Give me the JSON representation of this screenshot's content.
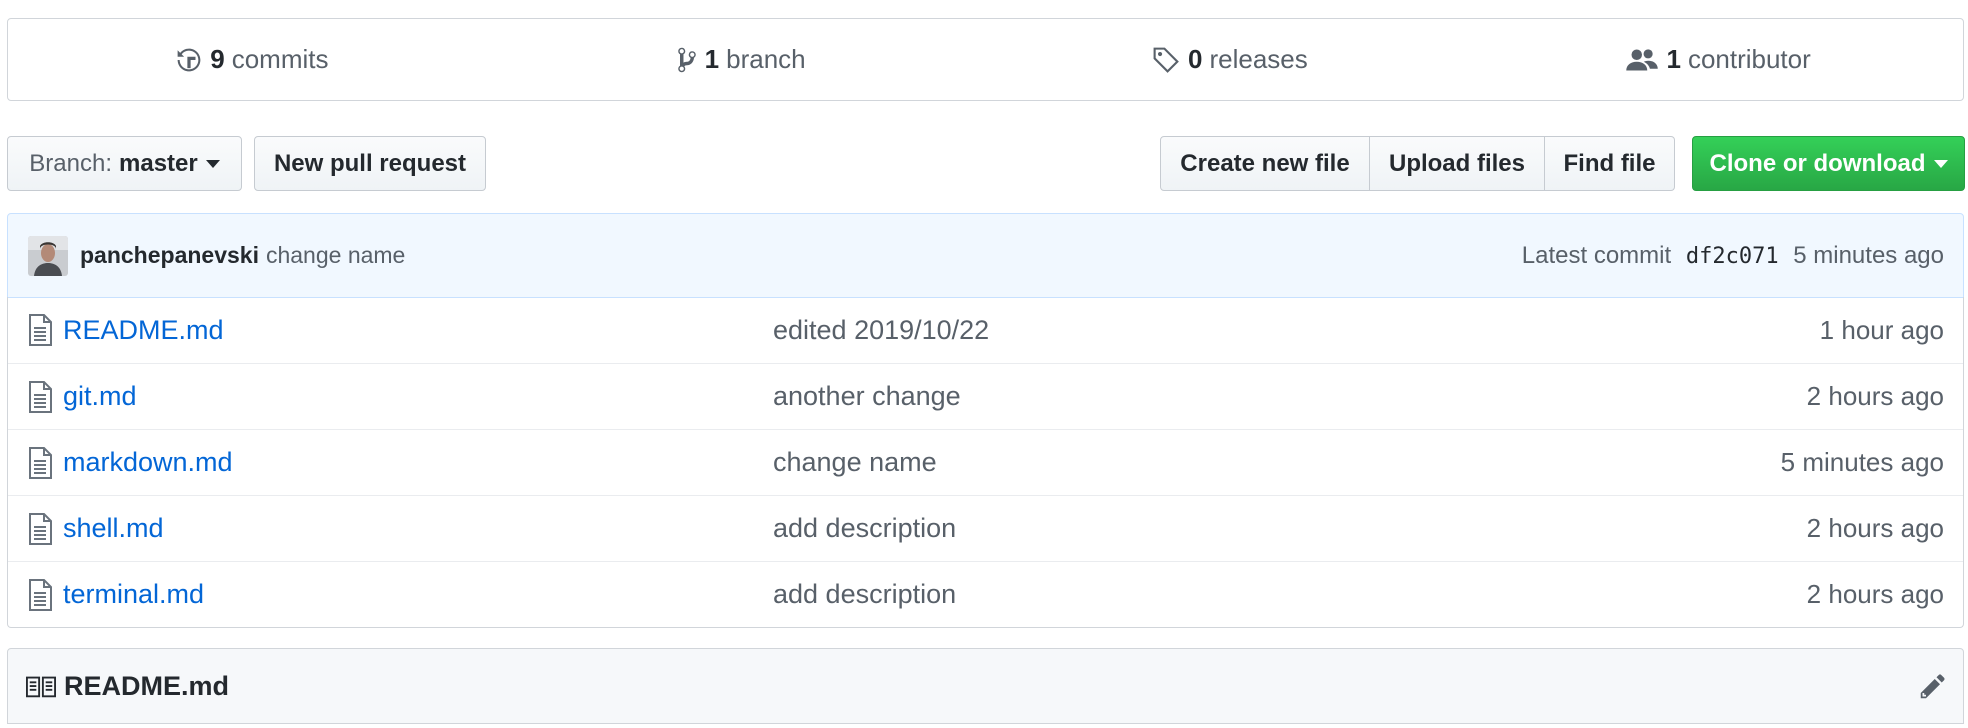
{
  "summary": {
    "commits": {
      "count": "9",
      "label": "commits",
      "icon": "history-icon"
    },
    "branches": {
      "count": "1",
      "label": "branch",
      "icon": "git-branch-icon"
    },
    "releases": {
      "count": "0",
      "label": "releases",
      "icon": "tag-icon"
    },
    "contributors": {
      "count": "1",
      "label": "contributor",
      "icon": "people-icon"
    }
  },
  "toolbar": {
    "branch_prefix": "Branch:",
    "branch_name": "master",
    "new_pull_request": "New pull request",
    "create_new_file": "Create new file",
    "upload_files": "Upload files",
    "find_file": "Find file",
    "clone_or_download": "Clone or download"
  },
  "latest_commit": {
    "author": "panchepanevski",
    "message": "change name",
    "label": "Latest commit",
    "sha": "df2c071",
    "age": "5 minutes ago"
  },
  "files": [
    {
      "name": "README.md",
      "message": "edited 2019/10/22",
      "age": "1 hour ago"
    },
    {
      "name": "git.md",
      "message": "another change",
      "age": "2 hours ago"
    },
    {
      "name": "markdown.md",
      "message": "change name",
      "age": "5 minutes ago"
    },
    {
      "name": "shell.md",
      "message": "add description",
      "age": "2 hours ago"
    },
    {
      "name": "terminal.md",
      "message": "add description",
      "age": "2 hours ago"
    }
  ],
  "readme": {
    "title": "README.md"
  },
  "colors": {
    "link": "#0366d6",
    "muted": "#586069",
    "green": "#28a745",
    "commit_bg": "#f1f8ff"
  }
}
